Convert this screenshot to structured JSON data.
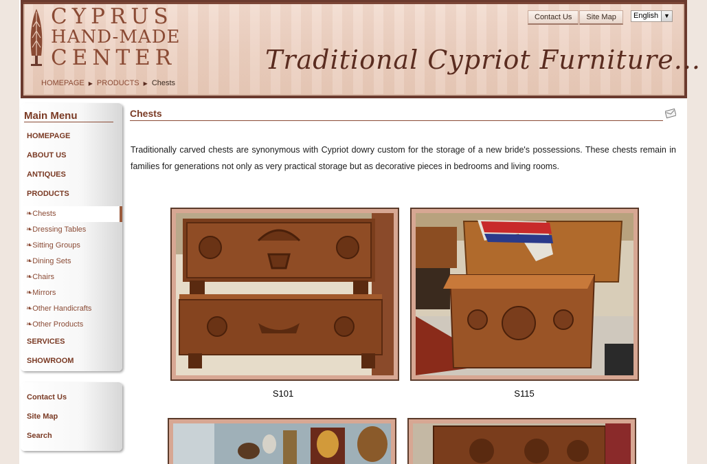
{
  "header": {
    "logo_line1": "CYPRUS",
    "logo_line2": "HAND-MADE",
    "logo_line3": "CENTER",
    "tagline": "Traditional Cypriot Furniture...",
    "breadcrumb": [
      "HOMEPAGE",
      "PRODUCTS",
      "Chests"
    ],
    "top_links": [
      "Contact Us",
      "Site Map"
    ],
    "language": "English"
  },
  "sidebar": {
    "title": "Main Menu",
    "items": [
      "HOMEPAGE",
      "ABOUT US",
      "ANTIQUES",
      "PRODUCTS"
    ],
    "sub_items": [
      "❧Chests",
      "❧Dressing Tables",
      "❧Sitting Groups",
      "❧Dining Sets",
      "❧Chairs",
      "❧Mirrors",
      "❧Other Handicrafts",
      "❧Other Products"
    ],
    "items_after": [
      "SERVICES",
      "SHOWROOM"
    ],
    "links": [
      "Contact Us",
      "Site Map",
      "Search"
    ]
  },
  "main": {
    "title": "Chests",
    "intro": "Traditionally carved chests are synonymous with Cypriot dowry custom for the storage of a new bride's possessions. These chests remain in families for generations not only as very practical storage but as decorative pieces in bedrooms and living rooms.",
    "products": [
      {
        "code": "S101"
      },
      {
        "code": "S115"
      }
    ]
  },
  "colors": {
    "brand": "#7a3a24",
    "header_border": "#6b3a2e",
    "photo_frame": "#d7a793"
  }
}
